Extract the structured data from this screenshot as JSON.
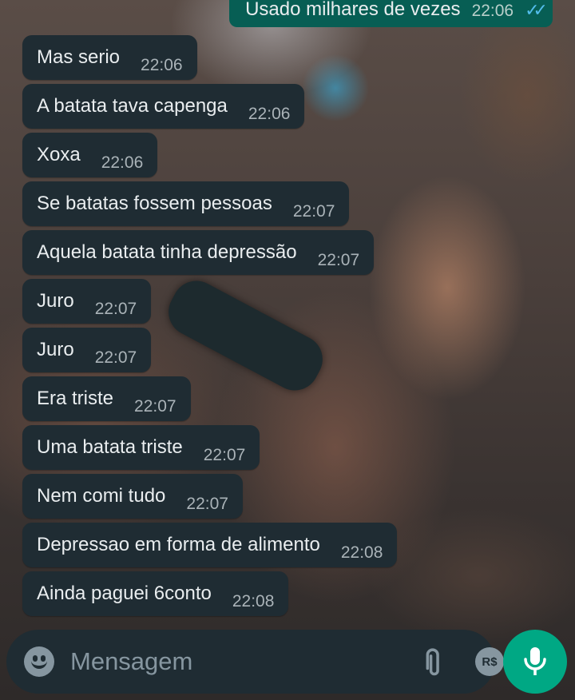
{
  "outgoing": {
    "text": "Usado milhares de vezes",
    "time": "22:06",
    "status_icon": "double-check-icon",
    "status_color": "#53bdeb"
  },
  "messages": [
    {
      "text": "Mas serio",
      "time": "22:06"
    },
    {
      "text": "A batata tava capenga",
      "time": "22:06"
    },
    {
      "text": "Xoxa",
      "time": "22:06"
    },
    {
      "text": "Se batatas fossem pessoas",
      "time": "22:07"
    },
    {
      "text": "Aquela batata tinha depressão",
      "time": "22:07"
    },
    {
      "text": "Juro",
      "time": "22:07"
    },
    {
      "text": "Juro",
      "time": "22:07"
    },
    {
      "text": "Era triste",
      "time": "22:07"
    },
    {
      "text": "Uma batata triste",
      "time": "22:07"
    },
    {
      "text": "Nem comi tudo",
      "time": "22:07"
    },
    {
      "text": "Depressao em forma de alimento",
      "time": "22:08"
    },
    {
      "text": "Ainda paguei 6conto",
      "time": "22:08"
    }
  ],
  "composer": {
    "placeholder": "Mensagem",
    "emoji_icon": "emoji-icon",
    "attach_icon": "paperclip-icon",
    "payment_label": "R$",
    "camera_icon": "camera-icon",
    "send_icon": "microphone-icon"
  },
  "colors": {
    "incoming_bubble": "#1f2c33",
    "outgoing_bubble": "#075e54",
    "accent": "#00a884",
    "icon": "#8696a0"
  }
}
